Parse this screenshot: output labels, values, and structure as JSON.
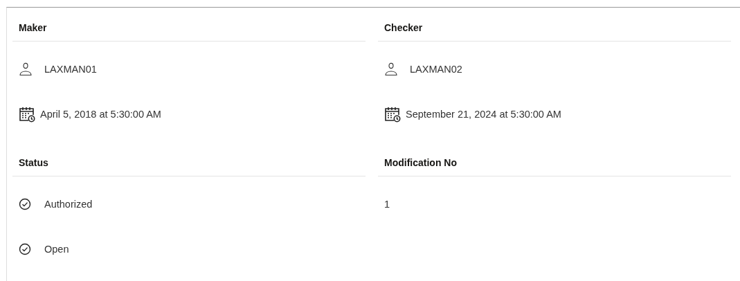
{
  "sections": [
    {
      "heading": "Maker",
      "items": [
        {
          "kind": "user",
          "text": "LAXMAN01"
        },
        {
          "kind": "datetime",
          "text": "April 5, 2018 at 5:30:00 AM"
        }
      ]
    },
    {
      "heading": "Checker",
      "items": [
        {
          "kind": "user",
          "text": "LAXMAN02"
        },
        {
          "kind": "datetime",
          "text": "September 21, 2024 at 5:30:00 AM"
        }
      ]
    },
    {
      "heading": "Status",
      "items": [
        {
          "kind": "status",
          "text": "Authorized"
        },
        {
          "kind": "status",
          "text": "Open"
        }
      ]
    },
    {
      "heading": "Modification No",
      "items": [
        {
          "kind": "plain",
          "text": "1"
        }
      ]
    }
  ]
}
